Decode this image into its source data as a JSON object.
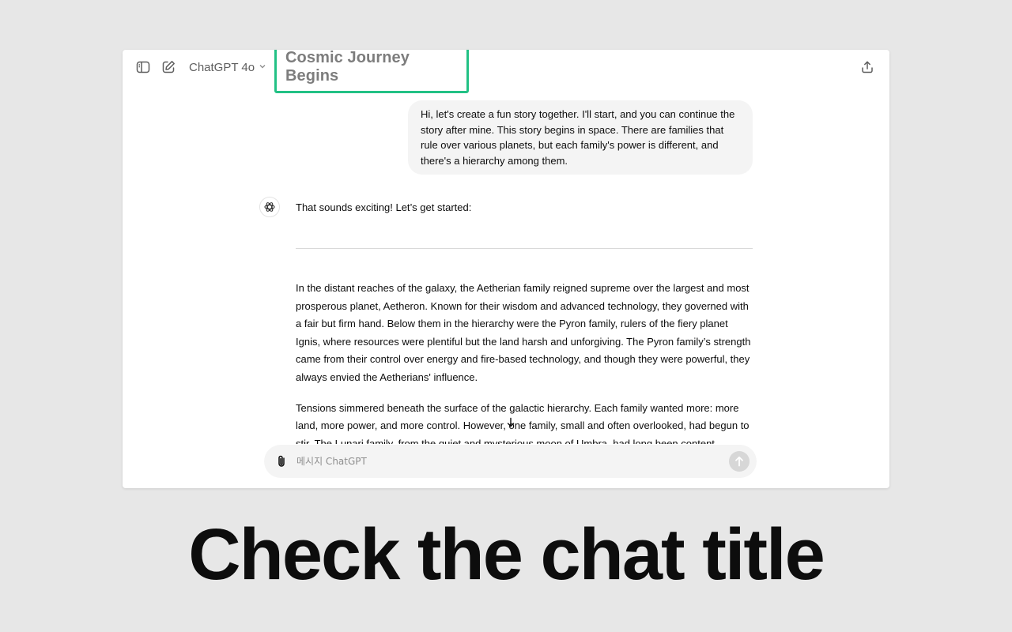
{
  "header": {
    "model_label": "ChatGPT 4o",
    "chat_title": "Cosmic Journey Begins",
    "icons": [
      "sidebar-toggle-icon",
      "new-chat-icon",
      "chevron-down-icon",
      "share-icon"
    ]
  },
  "conversation": {
    "user_message": "Hi, let's create a fun story together. I'll start, and you can continue the story after mine. This story begins in space. There are families that rule over various planets, but each family's power is different, and there's a hierarchy among them.",
    "assistant_intro": "That sounds exciting! Let’s get started:",
    "story_paragraphs": [
      "In the distant reaches of the galaxy, the Aetherian family reigned supreme over the largest and most prosperous planet, Aetheron. Known for their wisdom and advanced technology, they governed with a fair but firm hand. Below them in the hierarchy were the Pyron family, rulers of the fiery planet Ignis, where resources were plentiful but the land harsh and unforgiving. The Pyron family’s strength came from their control over energy and fire-based technology, and though they were powerful, they always envied the Aetherians' influence.",
      "Tensions simmered beneath the surface of the galactic hierarchy. Each family wanted more: more land, more power, and more control. However, one family, small and often overlooked, had begun to stir. The Lunari family, from the quiet and mysterious moon of Umbra, had long been content"
    ]
  },
  "composer": {
    "placeholder": "메시지 ChatGPT"
  },
  "caption": "Check the chat title",
  "colors": {
    "highlight": "#22c185",
    "background": "#e7e7e7",
    "bubble": "#f4f4f4"
  }
}
